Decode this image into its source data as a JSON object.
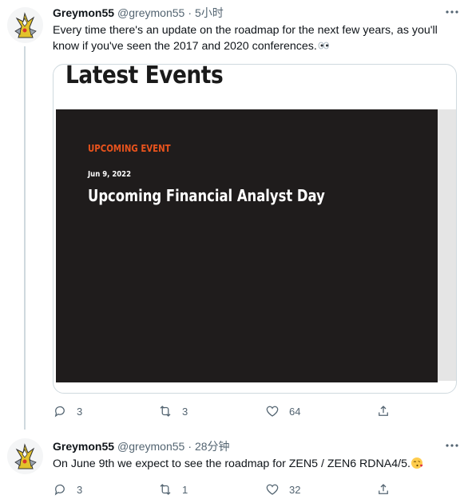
{
  "tweets": [
    {
      "name": "Greymon55",
      "handle": "@greymon55",
      "separator": "·",
      "time": "5小时",
      "text": "Every time there's an update on the roadmap for the next few years, as you'll know if you've seen the 2017 and 2020 conferences.",
      "trailing_emoji": "eyes-emoji",
      "card": {
        "title": "Latest Events",
        "event_label": "UPCOMING EVENT",
        "event_date": "Jun 9, 2022",
        "event_title": "Upcoming Financial Analyst Day",
        "panel_color": "#1f1c1c",
        "label_color": "#e8531d"
      },
      "actions": {
        "replies": "3",
        "retweets": "3",
        "likes": "64"
      }
    },
    {
      "name": "Greymon55",
      "handle": "@greymon55",
      "separator": "·",
      "time": "28分钟",
      "text": "On June 9th we expect to see the roadmap for ZEN5 / ZEN6 RDNA4/5.",
      "trailing_emoji": "kissing-heart-emoji",
      "actions": {
        "replies": "3",
        "retweets": "1",
        "likes": "32"
      }
    }
  ],
  "icons": {
    "reply": "reply-icon",
    "retweet": "retweet-icon",
    "like": "heart-icon",
    "share": "share-icon",
    "more": "more-icon"
  },
  "colors": {
    "muted": "#536471",
    "thread_line": "#cfd9de",
    "text": "#0f1419"
  }
}
